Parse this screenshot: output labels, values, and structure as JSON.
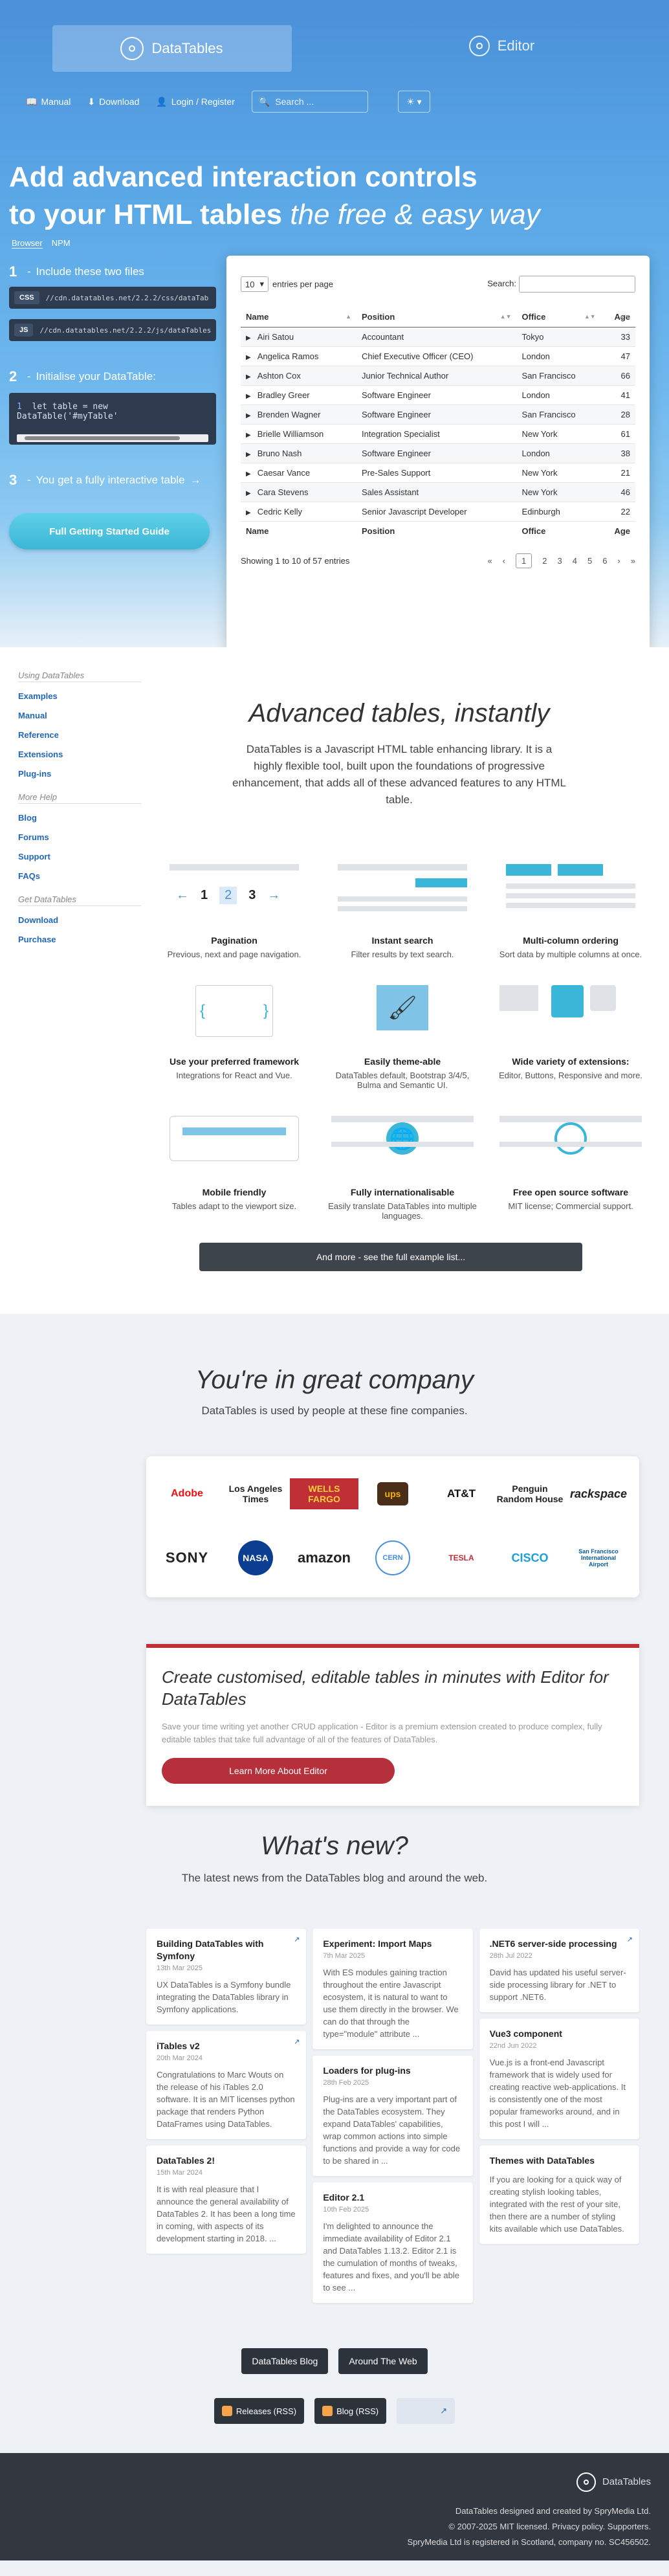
{
  "tabs": {
    "datatables": "DataTables",
    "editor": "Editor"
  },
  "nav": {
    "manual": "Manual",
    "download": "Download",
    "login": "Login / Register",
    "search_placeholder": "Search ..."
  },
  "hero": {
    "line1": "Add advanced interaction controls",
    "line2": "to your HTML tables",
    "line2_em": "the free & easy way",
    "subtabs": [
      "Browser",
      "NPM"
    ],
    "step1": "Include these two files",
    "css_label": "CSS",
    "css_url": "//cdn.datatables.net/2.2.2/css/dataTab",
    "js_label": "JS",
    "js_url": "//cdn.datatables.net/2.2.2/js/dataTables",
    "step2": "Initialise your DataTable:",
    "code": "let table = new DataTable('#myTable'",
    "step3": "You get a fully interactive table",
    "guide_btn": "Full Getting Started Guide"
  },
  "table": {
    "length_value": "10",
    "length_label": "entries per page",
    "search_label": "Search:",
    "headers": [
      "Name",
      "Position",
      "Office",
      "Age"
    ],
    "rows": [
      [
        "Airi Satou",
        "Accountant",
        "Tokyo",
        "33"
      ],
      [
        "Angelica Ramos",
        "Chief Executive Officer (CEO)",
        "London",
        "47"
      ],
      [
        "Ashton Cox",
        "Junior Technical Author",
        "San Francisco",
        "66"
      ],
      [
        "Bradley Greer",
        "Software Engineer",
        "London",
        "41"
      ],
      [
        "Brenden Wagner",
        "Software Engineer",
        "San Francisco",
        "28"
      ],
      [
        "Brielle Williamson",
        "Integration Specialist",
        "New York",
        "61"
      ],
      [
        "Bruno Nash",
        "Software Engineer",
        "London",
        "38"
      ],
      [
        "Caesar Vance",
        "Pre-Sales Support",
        "New York",
        "21"
      ],
      [
        "Cara Stevens",
        "Sales Assistant",
        "New York",
        "46"
      ],
      [
        "Cedric Kelly",
        "Senior Javascript Developer",
        "Edinburgh",
        "22"
      ]
    ],
    "info": "Showing 1 to 10 of 57 entries",
    "pages": [
      "«",
      "‹",
      "1",
      "2",
      "3",
      "4",
      "5",
      "6",
      "›",
      "»"
    ]
  },
  "sidebar": {
    "group1": "Using DataTables",
    "links1": [
      "Examples",
      "Manual",
      "Reference",
      "Extensions",
      "Plug-ins"
    ],
    "group2": "More Help",
    "links2": [
      "Blog",
      "Forums",
      "Support",
      "FAQs"
    ],
    "group3": "Get DataTables",
    "links3": [
      "Download",
      "Purchase"
    ]
  },
  "intro": {
    "title": "Advanced tables, instantly",
    "lead": "DataTables is a Javascript HTML table enhancing library. It is a highly flexible tool, built upon the foundations of progressive enhancement, that adds all of these advanced features to any HTML table."
  },
  "features": [
    {
      "title": "Pagination",
      "desc": "Previous, next and page navigation."
    },
    {
      "title": "Instant search",
      "desc": "Filter results by text search."
    },
    {
      "title": "Multi-column ordering",
      "desc": "Sort data by multiple columns at once."
    },
    {
      "title": "Use your preferred framework",
      "desc": "Integrations for React and Vue."
    },
    {
      "title": "Easily theme-able",
      "desc": "DataTables default, Bootstrap 3/4/5, Bulma and Semantic UI."
    },
    {
      "title": "Wide variety of extensions:",
      "desc": "Editor, Buttons, Responsive and more."
    },
    {
      "title": "Mobile friendly",
      "desc": "Tables adapt to the viewport size."
    },
    {
      "title": "Fully internationalisable",
      "desc": "Easily translate DataTables into multiple languages."
    },
    {
      "title": "Free open source software",
      "desc": "MIT license; Commercial support."
    }
  ],
  "pagination_demo": [
    "1",
    "2",
    "3"
  ],
  "more_btn": "And more - see the full example list...",
  "company": {
    "title": "You're in great company",
    "lead": "DataTables is used by people at these fine companies.",
    "logos": [
      "Adobe",
      "Los Angeles Times",
      "WELLS FARGO",
      "ups",
      "AT&T",
      "Penguin Random House",
      "rackspace",
      "SONY",
      "NASA",
      "amazon",
      "CERN",
      "TESLA",
      "CISCO",
      "San Francisco International Airport"
    ]
  },
  "editor": {
    "title": "Create customised, editable tables in minutes with Editor for DataTables",
    "desc": "Save your time writing yet another CRUD application - Editor is a premium extension created to produce complex, fully editable tables that take full advantage of all of the features of DataTables.",
    "btn": "Learn More About Editor"
  },
  "news": {
    "title": "What's new?",
    "lead": "The latest news from the DataTables blog and around the web.",
    "col1": [
      {
        "title": "Building DataTables with Symfony",
        "date": "13th Mar 2025",
        "text": "UX DataTables is a Symfony bundle integrating the DataTables library in Symfony applications."
      },
      {
        "title": "iTables v2",
        "date": "20th Mar 2024",
        "text": "Congratulations to Marc Wouts on the release of his iTables 2.0 software. It is an MIT licenses python package that renders Python DataFrames using DataTables."
      },
      {
        "title": "DataTables 2!",
        "date": "15th Mar 2024",
        "text": "It is with real pleasure that I announce the general availability of DataTables 2. It has been a long time in coming, with aspects of its development starting in 2018. ..."
      }
    ],
    "col2": [
      {
        "title": "Experiment: Import Maps",
        "date": "7th Mar 2025",
        "text": "With ES modules gaining traction throughout the entire Javascript ecosystem, it is natural to want to use them directly in the browser. We can do that through the type=\"module\" attribute ..."
      },
      {
        "title": "Loaders for plug-ins",
        "date": "28th Feb 2025",
        "text": "Plug-ins are a very important part of the DataTables ecosystem. They expand DataTables' capabilities, wrap common actions into simple functions and provide a way for code to be shared in ..."
      },
      {
        "title": "Editor 2.1",
        "date": "10th Feb 2025",
        "text": "I'm delighted to announce the immediate availability of Editor 2.1 and DataTables 1.13.2. Editor 2.1 is the cumulation of months of tweaks, features and fixes, and you'll be able to see ..."
      }
    ],
    "col3": [
      {
        "title": ".NET6 server-side processing",
        "date": "28th Jul 2022",
        "text": "David has updated his useful server-side processing library for .NET to support .NET6."
      },
      {
        "title": "Vue3 component",
        "date": "22nd Jun 2022",
        "text": "Vue.js is a front-end Javascript framework that is widely used for creating reactive web-applications. It is consistently one of the most popular frameworks around, and in this post I will ..."
      },
      {
        "title": "Themes with DataTables",
        "date": "",
        "text": "If you are looking for a quick way of creating stylish looking tables, integrated with the rest of your site, then there are a number of styling kits available which use DataTables."
      }
    ],
    "blog_btn": "DataTables Blog",
    "web_btn": "Around The Web",
    "rss1": "Releases (RSS)",
    "rss2": "Blog (RSS)"
  },
  "footer": {
    "brand": "DataTables",
    "line1": "DataTables designed and created by SpryMedia Ltd.",
    "line2": "© 2007-2025 MIT licensed. Privacy policy. Supporters.",
    "line3": "SpryMedia Ltd is registered in Scotland, company no. SC456502."
  }
}
